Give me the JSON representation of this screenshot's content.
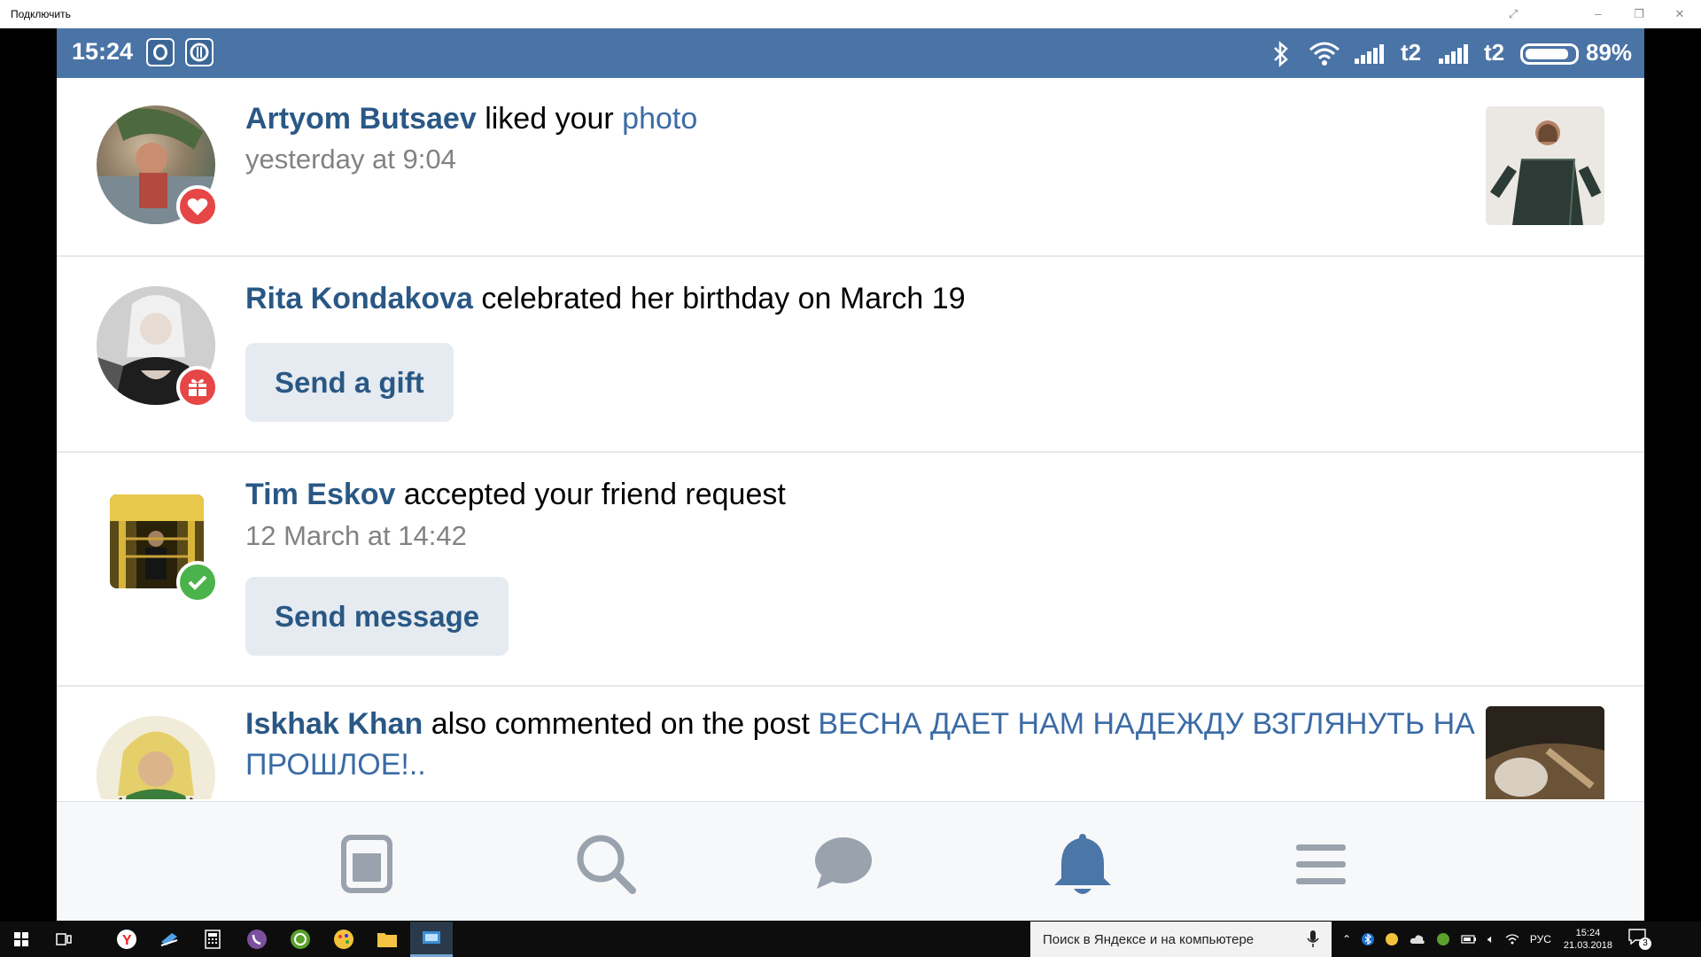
{
  "window": {
    "title": "Подключить"
  },
  "statusbar": {
    "time": "15:24",
    "carrier1": "t2",
    "carrier2": "t2",
    "battery_pct": "89%",
    "battery_level": 0.89
  },
  "notifications": [
    {
      "name": "Artyom Butsaev",
      "action": " liked your ",
      "link": "photo",
      "date": "yesterday at 9:04",
      "badge": "heart-icon"
    },
    {
      "name": "Rita Kondakova",
      "action": " celebrated her birthday on March 19",
      "button": "Send a gift",
      "badge": "gift-icon"
    },
    {
      "name": "Tim Eskov",
      "action": " accepted your friend request",
      "date": "12 March at 14:42",
      "button": "Send message",
      "badge": "check-icon"
    },
    {
      "name": "Iskhak Khan",
      "action": " also commented on the post ",
      "link_line1": "ВЕСНА ДАЕТ НАМ НАДЕЖДУ ВЗГЛЯНУТЬ НА",
      "link_line2": "ПРОШЛОЕ!.."
    }
  ],
  "bottomnav": {
    "items": [
      "news-icon",
      "search-icon",
      "messages-icon",
      "notifications-icon",
      "menu-icon"
    ],
    "active": "notifications-icon"
  },
  "taskbar": {
    "search_placeholder": "Поиск в Яндексе и на компьютере",
    "lang": "РУС",
    "clock_time": "15:24",
    "clock_date": "21.03.2018",
    "notif_count": "3"
  },
  "colors": {
    "statusbar": "#4a73a6",
    "link": "#2a5885",
    "button_bg": "#e5ebf1",
    "badge_red": "#e64646",
    "badge_green": "#4bb34b",
    "active_nav": "#4a76a8",
    "inactive_nav": "#99a2ad"
  }
}
